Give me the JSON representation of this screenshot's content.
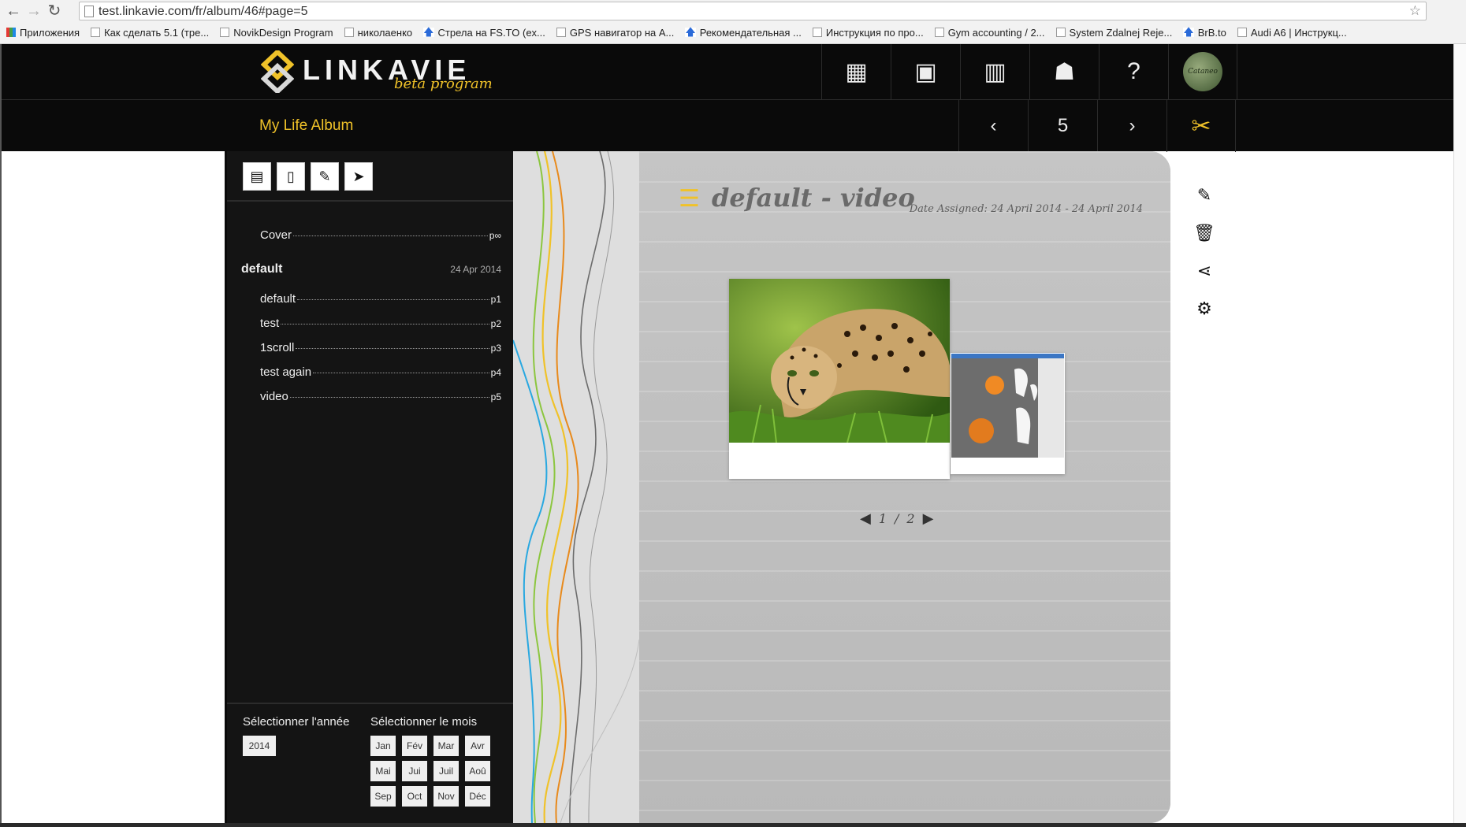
{
  "browser": {
    "url": "test.linkavie.com/fr/album/46#page=5",
    "bookmarks": [
      {
        "icon": "apps",
        "label": "Приложения"
      },
      {
        "icon": "page",
        "label": "Как сделать 5.1 (тре..."
      },
      {
        "icon": "page",
        "label": "NovikDesign Program"
      },
      {
        "icon": "page",
        "label": "николаенко"
      },
      {
        "icon": "arrow",
        "label": "Стрела на FS.TO (ex..."
      },
      {
        "icon": "page",
        "label": "GPS навигатор на A..."
      },
      {
        "icon": "arrow",
        "label": "Рекомендательная ..."
      },
      {
        "icon": "page",
        "label": "Инструкция по про..."
      },
      {
        "icon": "page",
        "label": "Gym accounting / 2..."
      },
      {
        "icon": "page",
        "label": "System Zdalnej Reje..."
      },
      {
        "icon": "arrow",
        "label": "BrB.to"
      },
      {
        "icon": "page",
        "label": "Audi A6 | Инструкц..."
      }
    ]
  },
  "header": {
    "logo_word": "LINKAVIE",
    "logo_sub": "beta program",
    "nav": [
      {
        "name": "calendar-icon",
        "glyph": "▦"
      },
      {
        "name": "album-icon",
        "glyph": "▣"
      },
      {
        "name": "timeline-grid-icon",
        "glyph": "▥"
      },
      {
        "name": "people-icon",
        "glyph": "☗"
      },
      {
        "name": "help-icon",
        "glyph": "?"
      }
    ],
    "avatar_text": "Cataneo"
  },
  "subheader": {
    "album_title": "My Life Album",
    "prev": "‹",
    "page_number": "5",
    "next": "›",
    "tools": "✂"
  },
  "sidebar": {
    "tools": [
      {
        "name": "add-page-icon",
        "glyph": "▤"
      },
      {
        "name": "new-page-icon",
        "glyph": "▯"
      },
      {
        "name": "edit-icon",
        "glyph": "✎"
      },
      {
        "name": "pointer-icon",
        "glyph": "➤"
      }
    ],
    "cover": {
      "label": "Cover",
      "page": "p∞"
    },
    "group": {
      "name": "default",
      "date": "24 Apr 2014"
    },
    "items": [
      {
        "label": "default",
        "page": "p1"
      },
      {
        "label": "test",
        "page": "p2"
      },
      {
        "label": "1scroll",
        "page": "p3"
      },
      {
        "label": "test again",
        "page": "p4"
      },
      {
        "label": "video",
        "page": "p5"
      }
    ],
    "year_label": "Sélectionner l'année",
    "month_label": "Sélectionner le mois",
    "year": "2014",
    "months": [
      "Jan",
      "Fév",
      "Mar",
      "Avr",
      "Mai",
      "Jui",
      "Juil",
      "Aoû",
      "Sep",
      "Oct",
      "Nov",
      "Déc"
    ]
  },
  "page": {
    "title": "default - video",
    "date_assigned": "Date Assigned: 24 April 2014 - 24 April 2014",
    "current": "1",
    "separator": "/",
    "total": "2"
  },
  "colors": {
    "accent": "#f0c229",
    "header_bg": "#0a0a0a",
    "sidebar_bg": "#141414"
  }
}
